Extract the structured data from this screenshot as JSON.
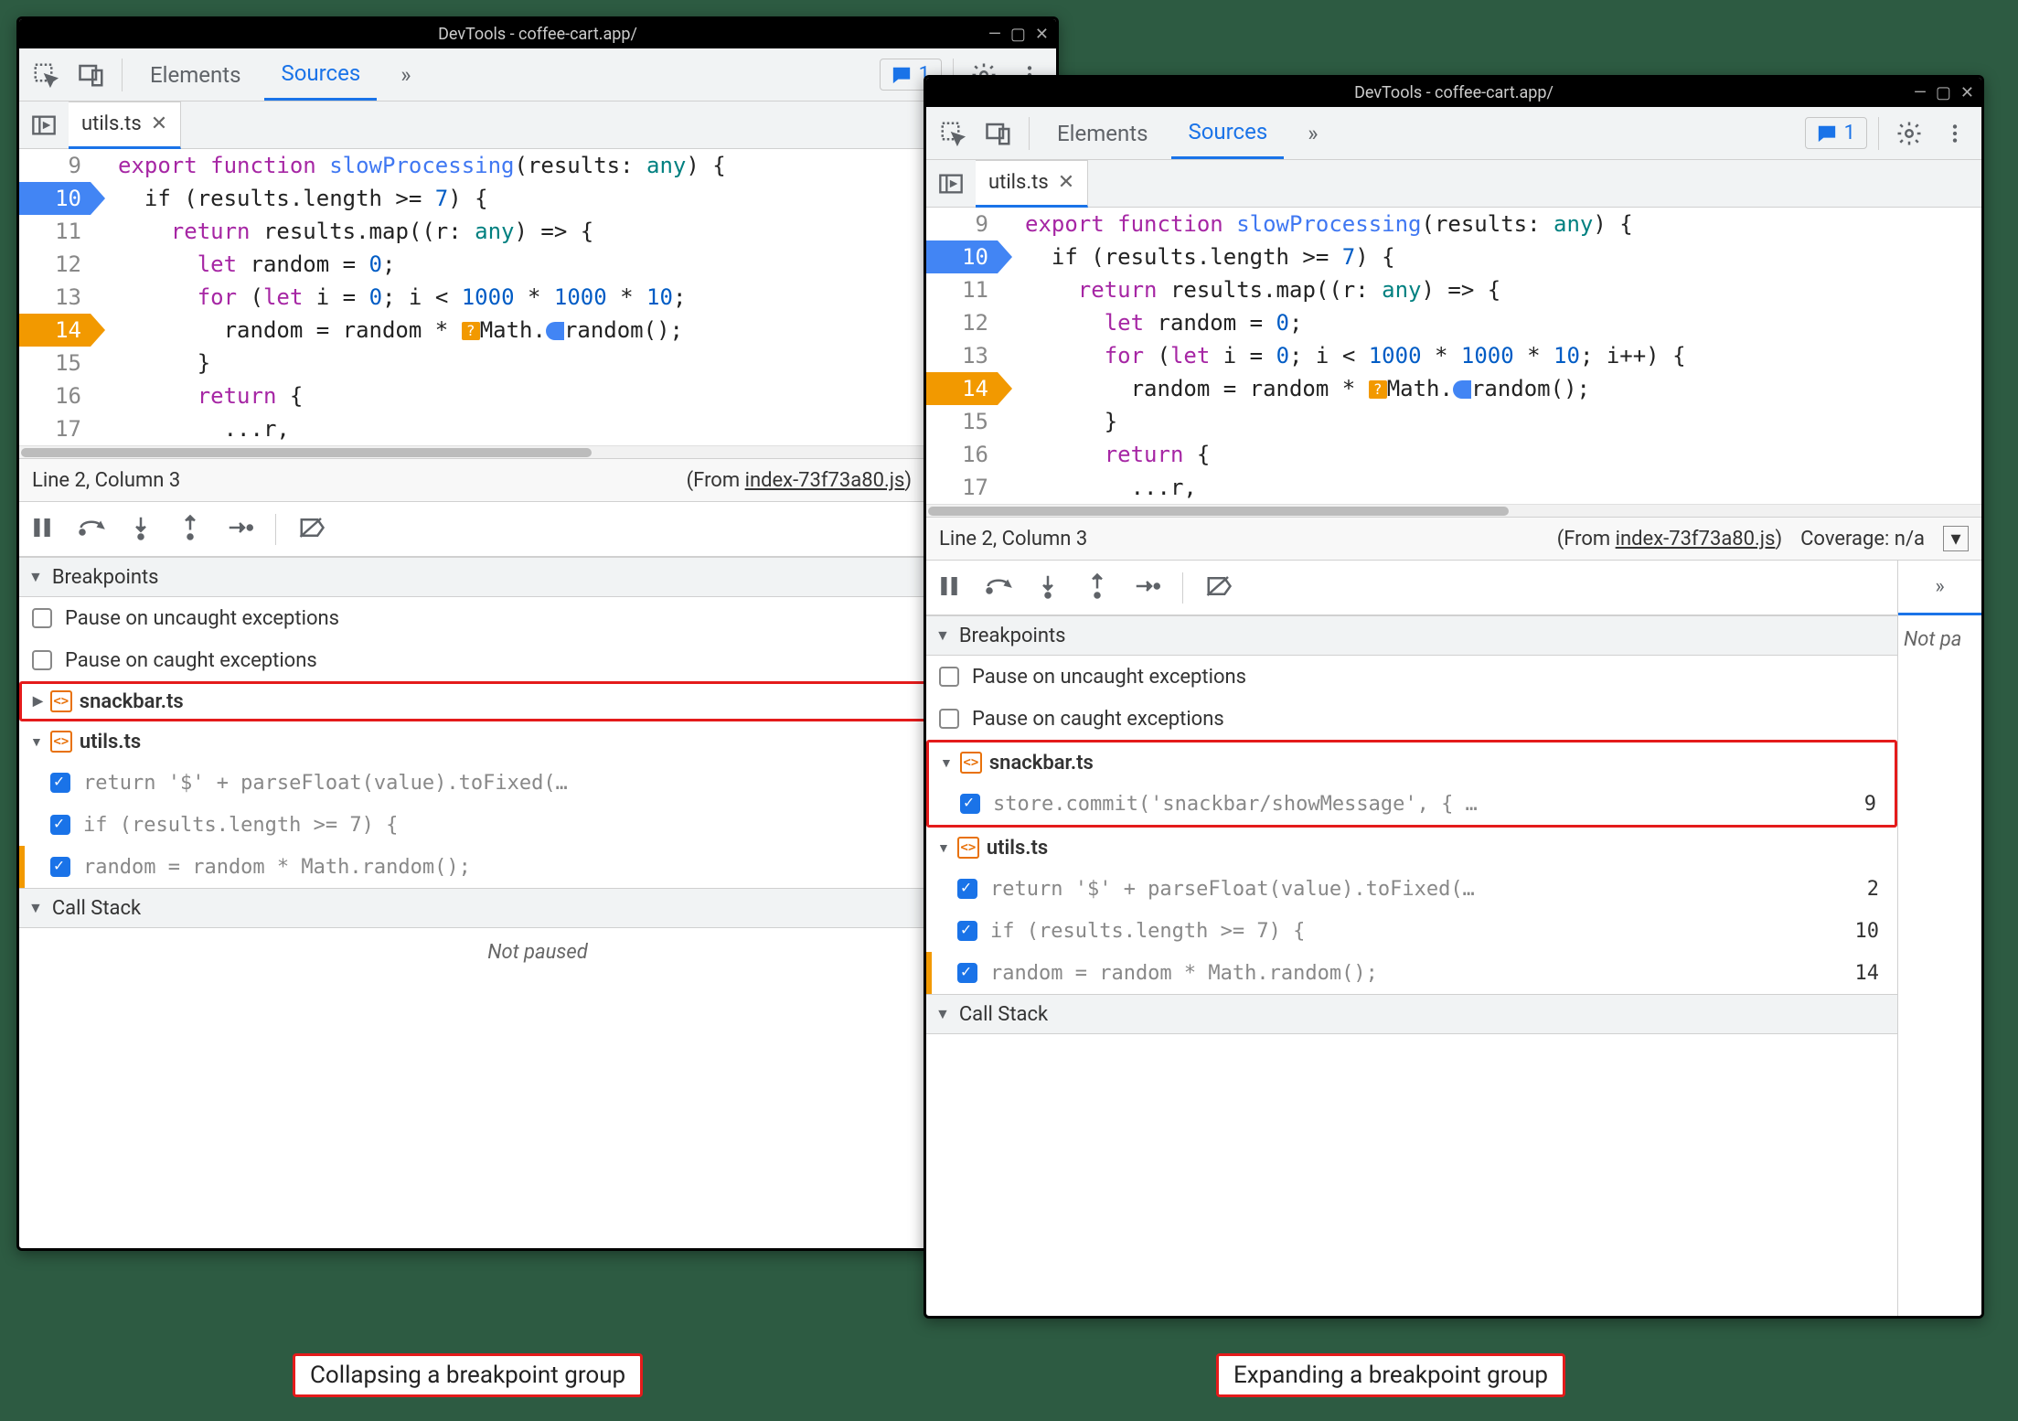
{
  "titlebar": {
    "title": "DevTools - coffee-cart.app/"
  },
  "tabs": {
    "elements": "Elements",
    "sources": "Sources",
    "more": "»",
    "messages": "1"
  },
  "file_tab": "utils.ts",
  "code": {
    "lines": [
      "9",
      "10",
      "11",
      "12",
      "13",
      "14",
      "15",
      "16",
      "17"
    ],
    "l9a": "export",
    "l9b": " function",
    "l9c": " slowProcessing",
    "l9d": "(",
    "l9e": "results",
    "l9f": ": ",
    "l9g": "any",
    "l9h": ") {",
    "l10": "  if (results.length >= ",
    "l10n": "7",
    "l10b": ") {",
    "l11a": "    return",
    "l11b": " results.map((",
    "l11c": "r",
    "l11d": ": ",
    "l11e": "any",
    "l11f": ") => {",
    "l12a": "      let",
    "l12b": " random = ",
    "l12n": "0",
    "l12c": ";",
    "l13a": "      for",
    "l13b": " (",
    "l13c": "let",
    "l13d": " i = ",
    "l13n1": "0",
    "l13e": "; i < ",
    "l13n2": "1000",
    "l13f": " * ",
    "l13n3": "1000",
    "l13g": " * ",
    "l13n4": "10",
    "l13h": "; i++) {",
    "l13h_short": ";",
    "l14a": "        random = random * ",
    "l14b": "Math.",
    "l14c": "random();",
    "l15": "      }",
    "l16a": "      return",
    "l16b": " {",
    "l17": "        ...r,"
  },
  "status": {
    "pos": "Line 2, Column 3",
    "from_prefix": "(From ",
    "from_file": "index-73f73a80.js",
    "from_suffix": ")",
    "coverage_left": "Coverage: n/",
    "coverage_right": "Coverage: n/a"
  },
  "panels": {
    "breakpoints": "Breakpoints",
    "callstack": "Call Stack",
    "pause_uncaught": "Pause on uncaught exceptions",
    "pause_caught": "Pause on caught exceptions",
    "not_paused": "Not paused"
  },
  "groups": {
    "snackbar": "snackbar.ts",
    "utils": "utils.ts"
  },
  "bp": {
    "snackbar1_txt": "store.commit('snackbar/showMessage', { …",
    "snackbar1_ln": "9",
    "utils1_txt": "return '$' + parseFloat(value).toFixed(…",
    "utils1_ln": "2",
    "utils2_txt": "if (results.length >= 7) {",
    "utils2_ln": "10",
    "utils3_txt": "random = random * Math.random();",
    "utils3_ln": "14"
  },
  "captions": {
    "left": "Collapsing a breakpoint group",
    "right": "Expanding a breakpoint group"
  },
  "right_sidebar": {
    "more": "»",
    "notpa": "Not pa"
  }
}
